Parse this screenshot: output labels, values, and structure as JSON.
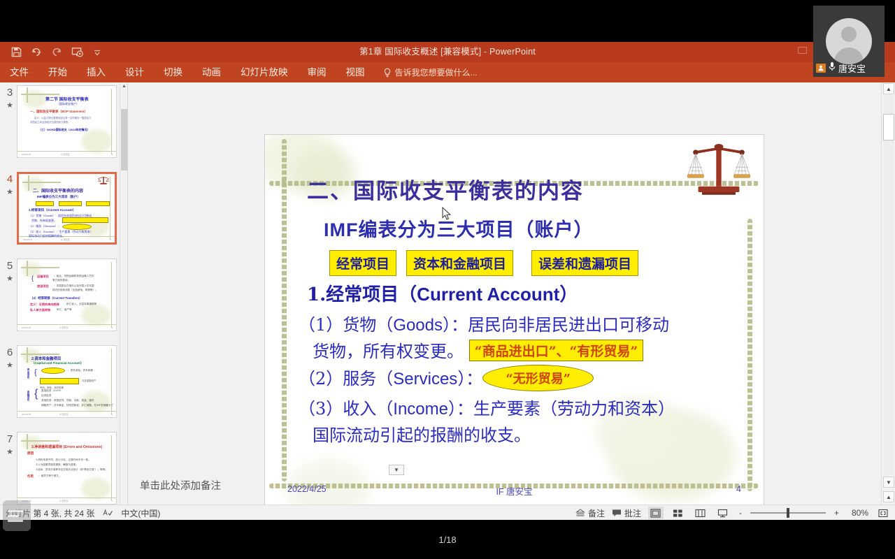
{
  "window": {
    "title": "第1章 国际收支概述 [兼容模式] - PowerPoint",
    "quick_access": [
      {
        "name": "save-icon",
        "label": "保存"
      },
      {
        "name": "undo-icon",
        "label": "撤消"
      },
      {
        "name": "redo-icon",
        "label": "恢复"
      },
      {
        "name": "start-slideshow-icon",
        "label": "从头开始"
      },
      {
        "name": "customize-qat-icon",
        "label": "自定义快速访问工具栏"
      }
    ],
    "restore_button": "还原"
  },
  "ribbon": {
    "tabs": [
      "文件",
      "开始",
      "插入",
      "设计",
      "切换",
      "动画",
      "幻灯片放映",
      "审阅",
      "视图"
    ],
    "tell_me": "告诉我您想要做什么..."
  },
  "thumbnails": {
    "items": [
      {
        "number": "3",
        "selected": false,
        "title": "第二节  国际收支平衡表",
        "subtitle": "（国际收支账户）"
      },
      {
        "number": "4",
        "selected": true,
        "title": "二、国际收支平衡表的内容",
        "subtitle": "IMF编表分为三大项目（账户）"
      },
      {
        "number": "5",
        "selected": false,
        "title": "",
        "subtitle": "（4）经常转移（Current Transfers）"
      },
      {
        "number": "6",
        "selected": false,
        "title": "2.资本和金融项目",
        "subtitle": "（Capital and Financial Account）"
      },
      {
        "number": "7",
        "selected": false,
        "title": "3.净误差和遗漏项目（Errors and Omissions）",
        "subtitle": ""
      }
    ]
  },
  "slide": {
    "title": "二、国际收支平衡表的内容",
    "subtitle_cn": "编表分为三大项目（账户）",
    "subtitle_en": "IMF",
    "category_boxes": [
      "经常项目",
      "资本和金融项目",
      "误差和遗漏项目"
    ],
    "heading_num": "1.",
    "heading_cn": "经常项目（",
    "heading_en": "Current Account",
    "heading_tail": "）",
    "bullets": [
      {
        "lead": "（1）货物（",
        "en": "Goods",
        "mid": "）：居民向非居民进出口可移动",
        "line2": "货物，所有权变更。",
        "highlight_box": "“商品进出口”、“有形贸易”",
        "highlight_ellipse": ""
      },
      {
        "lead": "（2）服务（",
        "en": "Services",
        "mid": "）：",
        "line2": "",
        "highlight_box": "",
        "highlight_ellipse": "“无形贸易”"
      },
      {
        "lead": "（3）收入（",
        "en": "Income",
        "mid": "）：生产要素（劳动力和资本）",
        "line2": "国际流动引起的报酬的收支。",
        "highlight_box": "",
        "highlight_ellipse": ""
      }
    ],
    "footer_left": "2022/4/25",
    "footer_center": "IF  唐安宝",
    "footer_right": "4",
    "decor_icon": "balance-scales-icon"
  },
  "notes": {
    "placeholder": "单击此处添加备注",
    "collapse_icon": "chevron-down-icon"
  },
  "status": {
    "slide_count": "幻灯片 第 4 张,  共 24 张",
    "spellcheck_icon": "spellcheck-icon",
    "language": "中文(中国)",
    "notes_button": "备注",
    "comments_button": "批注",
    "views": [
      {
        "name": "normal-view-icon",
        "active": true
      },
      {
        "name": "slide-sorter-icon",
        "active": false
      },
      {
        "name": "reading-view-icon",
        "active": false
      },
      {
        "name": "slideshow-view-icon",
        "active": false
      }
    ],
    "zoom_out": "-",
    "zoom_in": "+",
    "zoom_level": "80%",
    "fit_icon": "fit-to-window-icon"
  },
  "overlay": {
    "camera_name": "唐安宝",
    "camera_avatar": "person-avatar-icon",
    "peer_icon": "participant-icon",
    "mic_icon": "microphone-icon",
    "page_indicator": "1/18",
    "floating_widget": "menu-list-icon"
  },
  "colors": {
    "titlebar": "#b83b1d",
    "ribbon": "#c0441f",
    "accent_blue": "#2d2db0",
    "highlight_yellow": "#ffee00",
    "highlight_red": "#d0430e",
    "selection_border": "#e2694a"
  }
}
